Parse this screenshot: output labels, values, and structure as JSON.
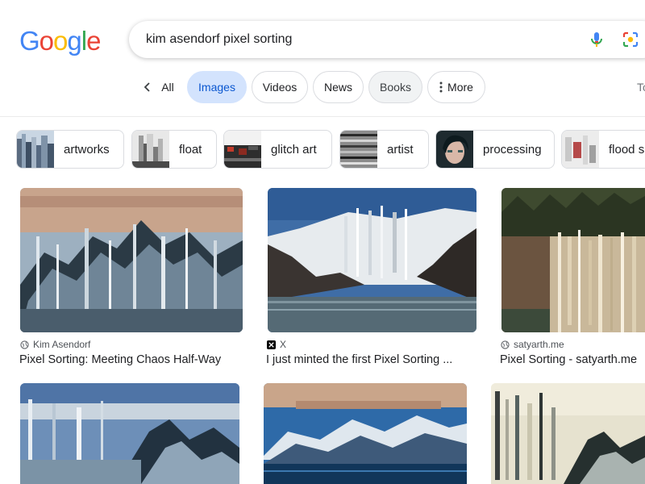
{
  "logo": {
    "letters": [
      "G",
      "o",
      "o",
      "g",
      "l",
      "e"
    ],
    "colors": [
      "#4285F4",
      "#EA4335",
      "#FBBC05",
      "#4285F4",
      "#34A853",
      "#EA4335"
    ]
  },
  "search": {
    "query": "kim asendorf pixel sorting",
    "mic_icon": "mic-icon",
    "lens_icon": "google-lens-icon"
  },
  "tabs": {
    "back_icon": "chevron-left-icon",
    "all": "All",
    "images": "Images",
    "videos": "Videos",
    "news": "News",
    "books": "Books",
    "more_icon": "vertical-dots-icon",
    "more": "More",
    "tools": "To"
  },
  "chips": [
    {
      "label": "artworks"
    },
    {
      "label": "float"
    },
    {
      "label": "glitch art"
    },
    {
      "label": "artist"
    },
    {
      "label": "processing"
    },
    {
      "label": "flood s"
    }
  ],
  "results": [
    {
      "source": "Kim Asendorf",
      "source_icon": "globe-icon",
      "title": "Pixel Sorting: Meeting Chaos Half-Way"
    },
    {
      "source": "X",
      "source_icon": "x-logo-icon",
      "title": "I just minted the first Pixel Sorting ..."
    },
    {
      "source": "satyarth.me",
      "source_icon": "globe-icon",
      "title": "Pixel Sorting - satyarth.me"
    },
    {
      "source": "",
      "title": ""
    },
    {
      "source": "",
      "title": ""
    },
    {
      "source": "",
      "title": ""
    }
  ],
  "colors": {
    "active_tab_bg": "#d3e3fd",
    "active_tab_text": "#0b57d0",
    "border": "#dadce0"
  }
}
